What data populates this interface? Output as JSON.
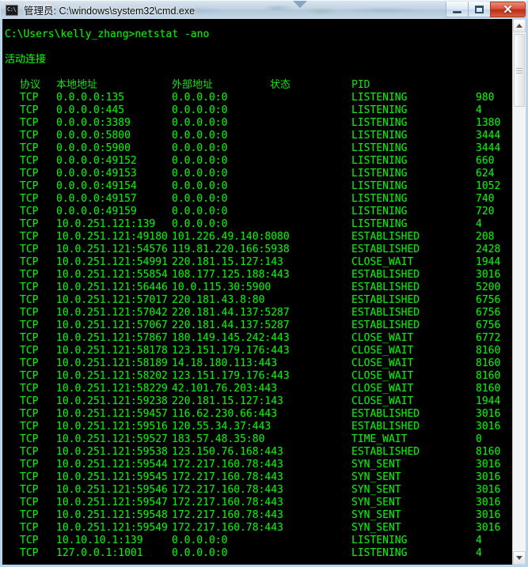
{
  "window": {
    "title": "管理员: C:\\windows\\system32\\cmd.exe",
    "icon": "cmd-console-icon",
    "icon_glyph": "C:\\",
    "minimize_label": "最小化",
    "maximize_label": "最大化",
    "close_label": "关闭",
    "close_glyph": "✕"
  },
  "console": {
    "prompt_line": "C:\\Users\\kelly_zhang>netstat -ano",
    "section_title": "活动连接",
    "headers": {
      "protocol": "协议",
      "local_address": "本地地址",
      "foreign_address": "外部地址",
      "state": "状态",
      "pid": "PID"
    },
    "background_color": "#000000",
    "text_color": "#13e313",
    "rows": [
      {
        "protocol": "TCP",
        "local": "0.0.0.0:135",
        "foreign": "0.0.0.0:0",
        "state": "LISTENING",
        "pid": "980"
      },
      {
        "protocol": "TCP",
        "local": "0.0.0.0:445",
        "foreign": "0.0.0.0:0",
        "state": "LISTENING",
        "pid": "4"
      },
      {
        "protocol": "TCP",
        "local": "0.0.0.0:3389",
        "foreign": "0.0.0.0:0",
        "state": "LISTENING",
        "pid": "1380"
      },
      {
        "protocol": "TCP",
        "local": "0.0.0.0:5800",
        "foreign": "0.0.0.0:0",
        "state": "LISTENING",
        "pid": "3444"
      },
      {
        "protocol": "TCP",
        "local": "0.0.0.0:5900",
        "foreign": "0.0.0.0:0",
        "state": "LISTENING",
        "pid": "3444"
      },
      {
        "protocol": "TCP",
        "local": "0.0.0.0:49152",
        "foreign": "0.0.0.0:0",
        "state": "LISTENING",
        "pid": "660"
      },
      {
        "protocol": "TCP",
        "local": "0.0.0.0:49153",
        "foreign": "0.0.0.0:0",
        "state": "LISTENING",
        "pid": "624"
      },
      {
        "protocol": "TCP",
        "local": "0.0.0.0:49154",
        "foreign": "0.0.0.0:0",
        "state": "LISTENING",
        "pid": "1052"
      },
      {
        "protocol": "TCP",
        "local": "0.0.0.0:49157",
        "foreign": "0.0.0.0:0",
        "state": "LISTENING",
        "pid": "740"
      },
      {
        "protocol": "TCP",
        "local": "0.0.0.0:49159",
        "foreign": "0.0.0.0:0",
        "state": "LISTENING",
        "pid": "720"
      },
      {
        "protocol": "TCP",
        "local": "10.0.251.121:139",
        "foreign": "0.0.0.0:0",
        "state": "LISTENING",
        "pid": "4"
      },
      {
        "protocol": "TCP",
        "local": "10.0.251.121:49180",
        "foreign": "101.226.49.140:8080",
        "state": "ESTABLISHED",
        "pid": "208"
      },
      {
        "protocol": "TCP",
        "local": "10.0.251.121:54576",
        "foreign": "119.81.220.166:5938",
        "state": "ESTABLISHED",
        "pid": "2428"
      },
      {
        "protocol": "TCP",
        "local": "10.0.251.121:54991",
        "foreign": "220.181.15.127:143",
        "state": "CLOSE_WAIT",
        "pid": "1944"
      },
      {
        "protocol": "TCP",
        "local": "10.0.251.121:55854",
        "foreign": "108.177.125.188:443",
        "state": "ESTABLISHED",
        "pid": "3016"
      },
      {
        "protocol": "TCP",
        "local": "10.0.251.121:56446",
        "foreign": "10.0.115.30:5900",
        "state": "ESTABLISHED",
        "pid": "5200"
      },
      {
        "protocol": "TCP",
        "local": "10.0.251.121:57017",
        "foreign": "220.181.43.8:80",
        "state": "ESTABLISHED",
        "pid": "6756"
      },
      {
        "protocol": "TCP",
        "local": "10.0.251.121:57042",
        "foreign": "220.181.44.137:5287",
        "state": "ESTABLISHED",
        "pid": "6756"
      },
      {
        "protocol": "TCP",
        "local": "10.0.251.121:57067",
        "foreign": "220.181.44.137:5287",
        "state": "ESTABLISHED",
        "pid": "6756"
      },
      {
        "protocol": "TCP",
        "local": "10.0.251.121:57867",
        "foreign": "180.149.145.242:443",
        "state": "CLOSE_WAIT",
        "pid": "6772"
      },
      {
        "protocol": "TCP",
        "local": "10.0.251.121:58178",
        "foreign": "123.151.179.176:443",
        "state": "CLOSE_WAIT",
        "pid": "8160"
      },
      {
        "protocol": "TCP",
        "local": "10.0.251.121:58189",
        "foreign": "14.18.180.113:443",
        "state": "CLOSE_WAIT",
        "pid": "8160"
      },
      {
        "protocol": "TCP",
        "local": "10.0.251.121:58202",
        "foreign": "123.151.179.176:443",
        "state": "CLOSE_WAIT",
        "pid": "8160"
      },
      {
        "protocol": "TCP",
        "local": "10.0.251.121:58229",
        "foreign": "42.101.76.203:443",
        "state": "CLOSE_WAIT",
        "pid": "8160"
      },
      {
        "protocol": "TCP",
        "local": "10.0.251.121:59238",
        "foreign": "220.181.15.127:143",
        "state": "CLOSE_WAIT",
        "pid": "1944"
      },
      {
        "protocol": "TCP",
        "local": "10.0.251.121:59457",
        "foreign": "116.62.230.66:443",
        "state": "ESTABLISHED",
        "pid": "3016"
      },
      {
        "protocol": "TCP",
        "local": "10.0.251.121:59516",
        "foreign": "120.55.34.37:443",
        "state": "ESTABLISHED",
        "pid": "3016"
      },
      {
        "protocol": "TCP",
        "local": "10.0.251.121:59527",
        "foreign": "183.57.48.35:80",
        "state": "TIME_WAIT",
        "pid": "0"
      },
      {
        "protocol": "TCP",
        "local": "10.0.251.121:59538",
        "foreign": "123.150.76.168:443",
        "state": "ESTABLISHED",
        "pid": "8160"
      },
      {
        "protocol": "TCP",
        "local": "10.0.251.121:59544",
        "foreign": "172.217.160.78:443",
        "state": "SYN_SENT",
        "pid": "3016"
      },
      {
        "protocol": "TCP",
        "local": "10.0.251.121:59545",
        "foreign": "172.217.160.78:443",
        "state": "SYN_SENT",
        "pid": "3016"
      },
      {
        "protocol": "TCP",
        "local": "10.0.251.121:59546",
        "foreign": "172.217.160.78:443",
        "state": "SYN_SENT",
        "pid": "3016"
      },
      {
        "protocol": "TCP",
        "local": "10.0.251.121:59547",
        "foreign": "172.217.160.78:443",
        "state": "SYN_SENT",
        "pid": "3016"
      },
      {
        "protocol": "TCP",
        "local": "10.0.251.121:59548",
        "foreign": "172.217.160.78:443",
        "state": "SYN_SENT",
        "pid": "3016"
      },
      {
        "protocol": "TCP",
        "local": "10.0.251.121:59549",
        "foreign": "172.217.160.78:443",
        "state": "SYN_SENT",
        "pid": "3016"
      },
      {
        "protocol": "TCP",
        "local": "10.10.10.1:139",
        "foreign": "0.0.0.0:0",
        "state": "LISTENING",
        "pid": "4"
      },
      {
        "protocol": "TCP",
        "local": "127.0.0.1:1001",
        "foreign": "0.0.0.0:0",
        "state": "LISTENING",
        "pid": "4"
      }
    ]
  },
  "scrollbar": {
    "up_arrow": "scroll-up",
    "down_arrow": "scroll-down",
    "thumb": "scroll-thumb"
  }
}
